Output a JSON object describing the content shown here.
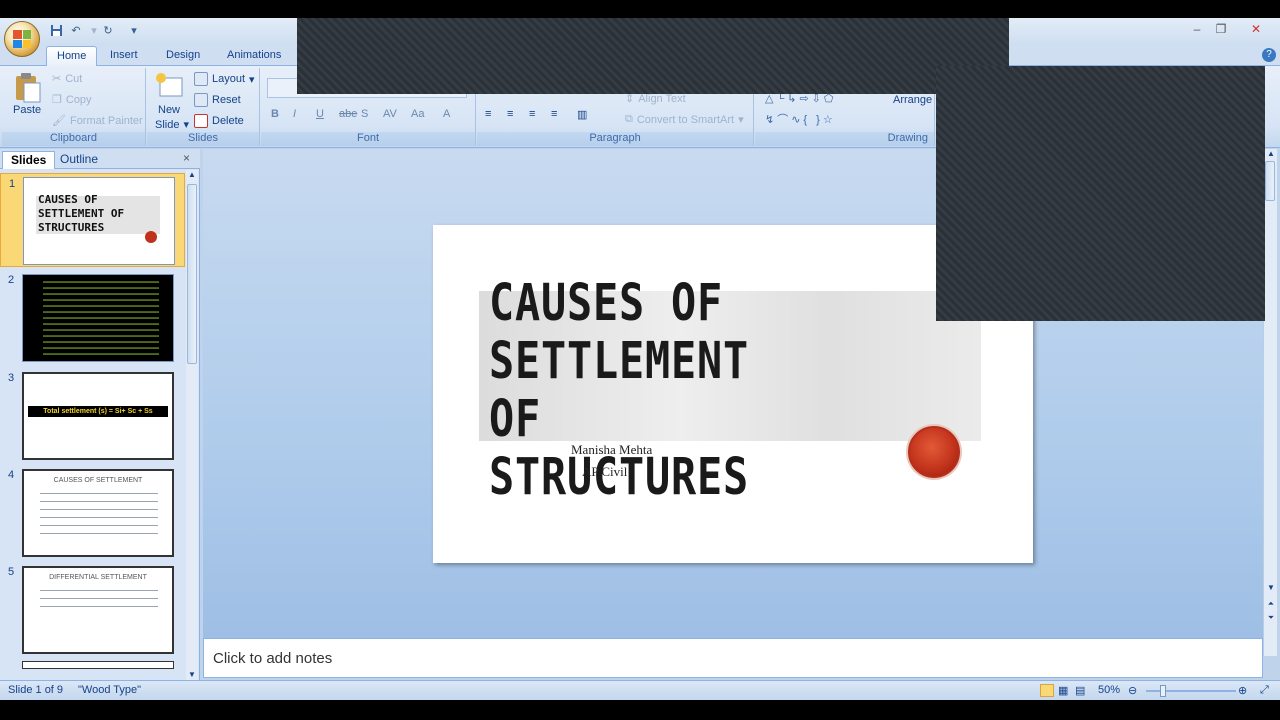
{
  "tabs": [
    "Home",
    "Insert",
    "Design",
    "Animations"
  ],
  "ribbon": {
    "clipboard": {
      "paste": "Paste",
      "cut": "Cut",
      "copy": "Copy",
      "format_painter": "Format Painter",
      "label": "Clipboard"
    },
    "slides": {
      "new_slide_1": "New",
      "new_slide_2": "Slide",
      "layout": "Layout",
      "reset": "Reset",
      "delete": "Delete",
      "label": "Slides"
    },
    "font": {
      "label": "Font"
    },
    "paragraph": {
      "align_text": "Align Text",
      "convert_smartart": "Convert to SmartArt",
      "label": "Paragraph"
    },
    "drawing": {
      "arrange": "Arrange",
      "label": "Drawing"
    }
  },
  "left_pane": {
    "tab_slides": "Slides",
    "tab_outline": "Outline",
    "close": "×",
    "thumbnails": [
      {
        "num": "1",
        "title": "CAUSES OF SETTLEMENT OF STRUCTURES"
      },
      {
        "num": "2",
        "title": ""
      },
      {
        "num": "3",
        "title": "Total settlement (s) = Si+ Sc + Ss"
      },
      {
        "num": "4",
        "title": "CAUSES OF SETTLEMENT"
      },
      {
        "num": "5",
        "title": "DIFFERENTIAL SETTLEMENT"
      }
    ]
  },
  "slide": {
    "title_line1": "CAUSES OF",
    "title_line2": "SETTLEMENT OF",
    "title_line3": "STRUCTURES",
    "author": "Manisha Mehta",
    "position": "AP Civil"
  },
  "notes": {
    "placeholder": "Click to add notes"
  },
  "status": {
    "slide_info": "Slide 1 of 9",
    "theme": "\"Wood Type\"",
    "zoom": "50%"
  }
}
